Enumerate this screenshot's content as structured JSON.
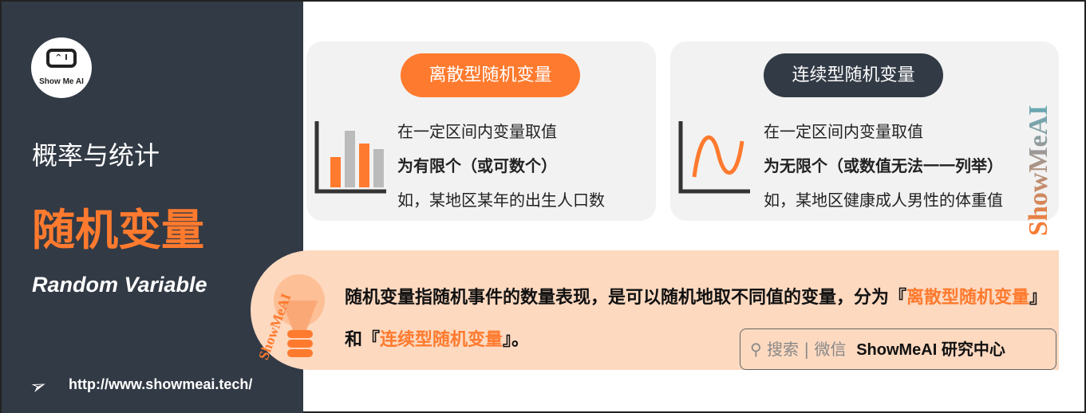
{
  "sidebar": {
    "logo_text": "Show Me AI",
    "logo_face": "^ I",
    "category": "概率与统计",
    "title": "随机变量",
    "title_en": "Random Variable",
    "url": "http://www.showmeai.tech/"
  },
  "cards": [
    {
      "label": "离散型随机变量",
      "lines": [
        "在一定区间内变量取值",
        "为有限个（或可数个）",
        "如，某地区某年的出生人口数"
      ],
      "icon": "bar-chart-icon",
      "pill_color": "#fe7a2e"
    },
    {
      "label": "连续型随机变量",
      "lines": [
        "在一定区间内变量取值",
        "为无限个（或数值无法一一列举）",
        "如，某地区健康成人男性的体重值"
      ],
      "icon": "wave-curve-icon",
      "pill_color": "#323a45"
    }
  ],
  "summary": {
    "text1": "随机变量指随机事件的数量表现，是可以随机地取不同值的变量，分为『",
    "hl1": "离散型随机变量",
    "text2": "』和『",
    "hl2": "连续型随机变量",
    "text3": "』。"
  },
  "search": {
    "label": "搜索 | 微信",
    "brand": "ShowMeAI 研究中心"
  },
  "watermark": "ShowMeAI",
  "colors": {
    "accent": "#fe7a2e",
    "dark": "#323a45",
    "band": "#fdd9c0"
  }
}
